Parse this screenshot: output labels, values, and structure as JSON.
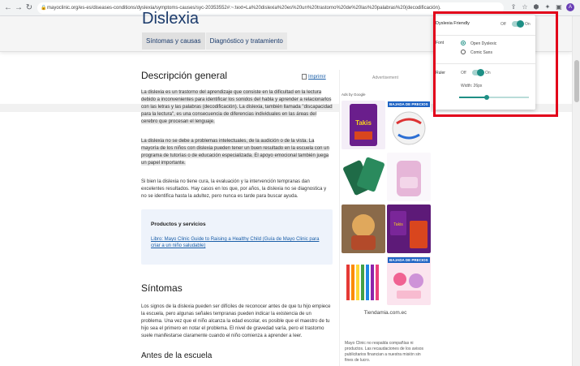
{
  "browser": {
    "url": "mayoclinic.org/es-es/diseases-conditions/dyslexia/symptoms-causes/syc-20353552#:~:text=La%20dislexia%20es%20un%20trastorno%20de%20las%20palabras%20(decodificación).",
    "back": "←",
    "forward": "→",
    "reload": "↻"
  },
  "header": {
    "title": "Dislexia",
    "tabs": [
      "Síntomas y causas",
      "Diagnóstico y tratamiento"
    ]
  },
  "main": {
    "overview_title": "Descripción general",
    "print_label": "Imprimir",
    "para1": "La dislexia es un trastorno del aprendizaje que consiste en la dificultad en la lectura debido a inconvenientes para identificar los sonidos del habla y aprender a relacionarlos con las letras y las palabras (decodificación). La dislexia, también llamada \"discapacidad para la lectura\", es una consecuencia de diferencias individuales en las áreas del cerebro que procesan el lenguaje.",
    "para2": "La dislexia no se debe a problemas intelectuales, de la audición o de la vista. La mayoría de los niños con dislexia pueden tener un buen resultado en la escuela con un programa de tutorías o de educación especializada. El apoyo emocional también juega un papel importante.",
    "para3": "Si bien la dislexia no tiene cura, la evaluación y la intervención tempranas dan excelentes resultados. Hay casos en los que, por años, la dislexia no se diagnostica y no se identifica hasta la adultez, pero nunca es tarde para buscar ayuda.",
    "card_title": "Productos y servicios",
    "card_link": "Libro: Mayo Clinic Guide to Raising a Healthy Child (Guía de Mayo  Clinic para criar a un niño saludable)",
    "symptoms_title": "Síntomas",
    "para4": "Los signos de la dislexia pueden ser difíciles de reconocer antes de que tu hijo empiece la escuela, pero algunas señales tempranas pueden indicar la existencia de un problema. Una vez que el niño alcanza la edad escolar, es posible que el maestro de tu hijo sea el primero en notar el problema. El nivel de gravedad varía, pero el trastorno suele manifestarse claramente cuando el niño comienza a aprender a leer.",
    "school_title": "Antes de la escuela"
  },
  "ads": {
    "label": "Advertisement",
    "ads_by": "Ads by Google",
    "badge": "BAJADA DE PRECIOS",
    "source": "Tiendamia.com.ec",
    "note": "Mayo Clinic no respalda compañías ni productos. Las recaudaciones de los avisos publicitarios financian a nuestra misión sin fines de lucro."
  },
  "extension": {
    "title": "Dyslexia Friendly",
    "off": "Off",
    "on": "On",
    "font_label": "Font",
    "font_options": [
      "Open Dyslexic",
      "Comic Sans"
    ],
    "ruler_label": "Ruler",
    "width_label": "Width: 26px",
    "slider_value": 0.4
  },
  "colors": {
    "accent": "#1e8f85",
    "link": "#1a5ea8",
    "annotation": "#e2001a"
  }
}
